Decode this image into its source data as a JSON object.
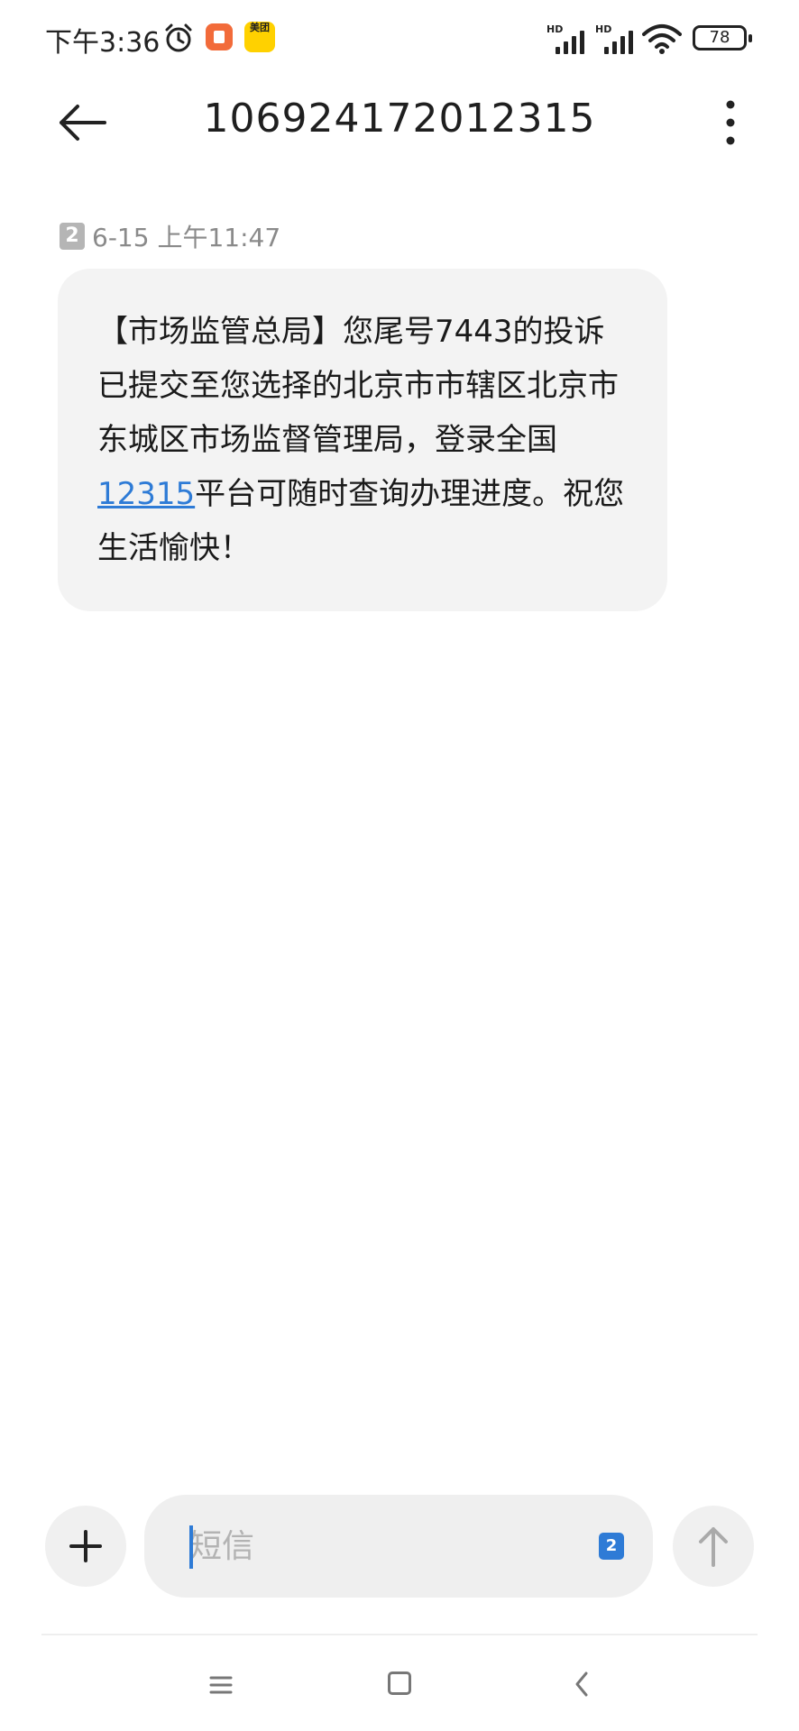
{
  "status_bar": {
    "time": "下午3:36",
    "battery_level": "78",
    "signal_1_label": "HD",
    "signal_2_label": "HD",
    "meituan_label": "美团"
  },
  "header": {
    "title": "106924172012315"
  },
  "message": {
    "sim_slot": "2",
    "timestamp": "6-15 上午11:47",
    "text_before_link": "【市场监管总局】您尾号7443的投诉已提交至您选择的北京市市辖区北京市东城区市场监督管理局，登录全国",
    "link_text": "12315",
    "text_after_link": "平台可随时查询办理进度。祝您生活愉快！"
  },
  "composer": {
    "placeholder": "短信",
    "sim_slot": "2"
  },
  "colors": {
    "accent": "#2e7bd6",
    "bubble_bg": "#f3f3f3",
    "meta_text": "#8a8a8a"
  }
}
